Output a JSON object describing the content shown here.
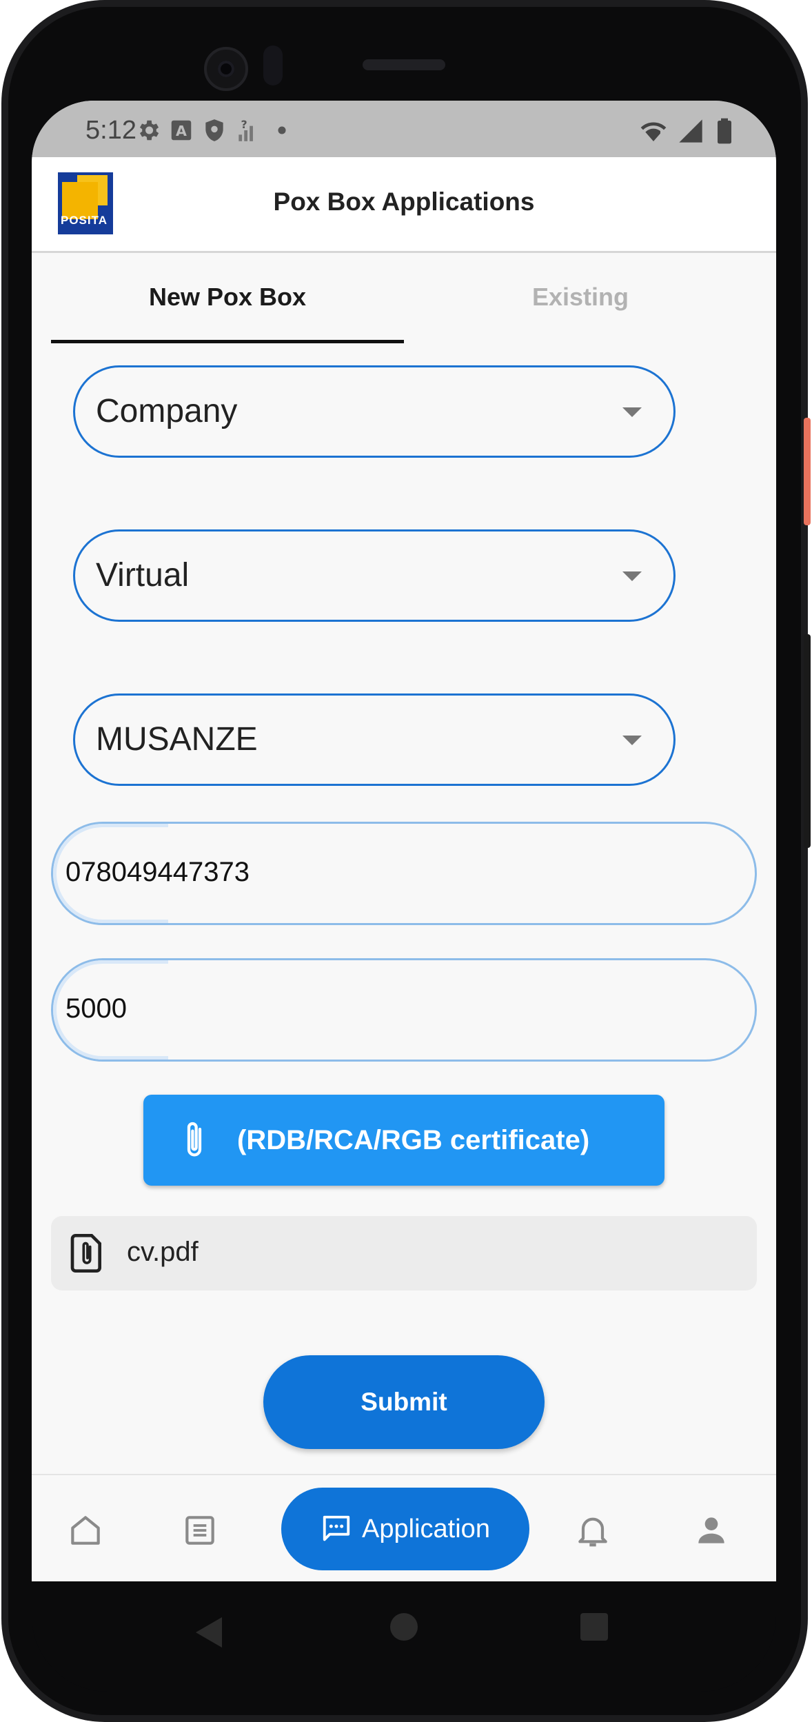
{
  "status_bar": {
    "time": "5:12",
    "icons": [
      "gear-icon",
      "a-keyboard-icon",
      "shield-icon",
      "signal-question-icon",
      "dot-icon"
    ],
    "right_icons": [
      "wifi-alert-icon",
      "cell-signal-icon",
      "battery-icon"
    ]
  },
  "app_bar": {
    "logo_text": "POSITA",
    "title": "Pox Box Applications"
  },
  "tabs": [
    {
      "label": "New Pox Box",
      "active": true
    },
    {
      "label": "Existing",
      "active": false
    }
  ],
  "form": {
    "applicant_type": "Company",
    "box_type": "Virtual",
    "location": "MUSANZE",
    "phone": "078049447373",
    "amount": "5000",
    "attach_label": "(RDB/RCA/RGB certificate)",
    "attached_file": "cv.pdf",
    "submit_label": "Submit"
  },
  "bottom_nav": {
    "items": [
      "home-icon",
      "list-icon",
      "application-icon",
      "bell-icon",
      "person-icon"
    ],
    "active_label": "Application"
  },
  "colors": {
    "primary": "#0f74d8",
    "attach": "#2196f3",
    "field_border": "#1c73d2",
    "status_bar": "#bdbdbd"
  }
}
